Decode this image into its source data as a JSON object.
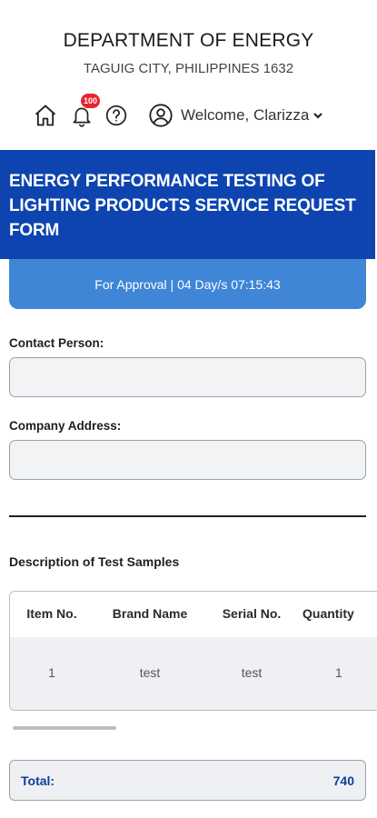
{
  "header": {
    "title": "DEPARTMENT OF ENERGY",
    "subtitle": "TAGUIG CITY, PHILIPPINES 1632",
    "notification_count": "100",
    "welcome_text": "Welcome, Clarizza",
    "icons": [
      "home-icon",
      "bell-icon",
      "help-icon",
      "user-icon",
      "chevron-down-icon"
    ]
  },
  "form": {
    "title": "ENERGY PERFORMANCE TESTING OF LIGHTING PRODUCTS SERVICE REQUEST FORM",
    "status": "For Approval | 04 Day/s 07:15:43",
    "contact_person": {
      "label": "Contact Person:",
      "value": ""
    },
    "company_address": {
      "label": "Company Address:",
      "value": ""
    }
  },
  "samples": {
    "title": "Description of Test Samples",
    "columns": [
      "Item No.",
      "Brand Name",
      "Serial No.",
      "Quantity"
    ],
    "rows": [
      [
        "1",
        "test",
        "test",
        "1"
      ]
    ],
    "total_label": "Total:",
    "total_value": "740"
  },
  "colors": {
    "banner": "#0d44b0",
    "status": "#3f86d6",
    "badge": "#e8232f",
    "total_text": "#0d3e9c"
  }
}
